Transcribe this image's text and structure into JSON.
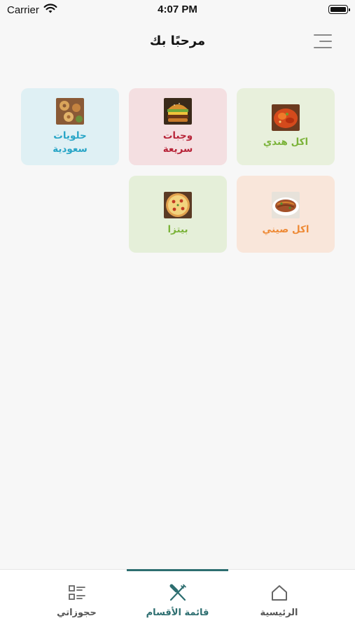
{
  "status_bar": {
    "carrier": "Carrier",
    "time": "4:07 PM"
  },
  "header": {
    "title": "مرحبًا بك"
  },
  "categories": [
    {
      "label": "اكل هندي",
      "color": "#7bb33a",
      "bg": "#e8f0dc",
      "icon": "indian-food-image"
    },
    {
      "label": "وجبات سريعة",
      "color": "#b8263a",
      "bg": "#f4dfe1",
      "icon": "burger-image"
    },
    {
      "label": "حلويات سعودية",
      "color": "#2aa6c7",
      "bg": "#dff0f4",
      "icon": "sweets-image"
    },
    {
      "label": "اكل صيني",
      "color": "#ee8a36",
      "bg": "#f9e6da",
      "icon": "chinese-food-image"
    },
    {
      "label": "بيتزا",
      "color": "#7bb33a",
      "bg": "#e5efd9",
      "icon": "pizza-image"
    }
  ],
  "tabbar": {
    "accent": "#2d6e70",
    "tabs": [
      {
        "label": "الرئيسية",
        "icon": "home-icon",
        "active": false
      },
      {
        "label": "قائمة الأقسام",
        "icon": "fork-knife-icon",
        "active": true
      },
      {
        "label": "حجوزاتي",
        "icon": "list-icon",
        "active": false
      }
    ]
  }
}
